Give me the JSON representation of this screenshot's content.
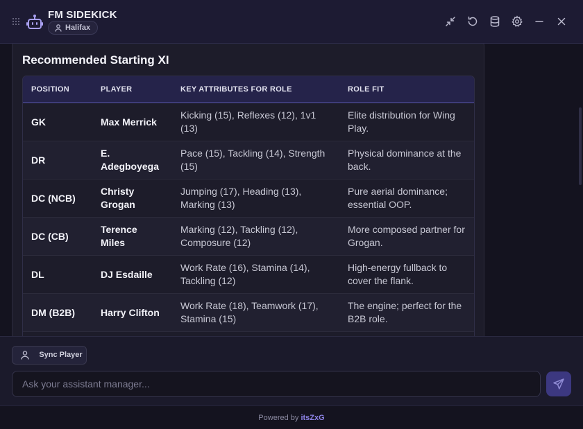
{
  "app": {
    "title": "FM SIDEKICK",
    "team": "Halifax"
  },
  "header_buttons": [
    "collapse-icon",
    "refresh-icon",
    "database-icon",
    "settings-icon",
    "minimize-icon",
    "close-icon"
  ],
  "section_title": "Recommended Starting XI",
  "table": {
    "headers": [
      "POSITION",
      "PLAYER",
      "KEY ATTRIBUTES FOR ROLE",
      "ROLE FIT"
    ],
    "rows": [
      {
        "position": "GK",
        "player": "Max Merrick",
        "attributes": "Kicking (15), Reflexes (12), 1v1 (13)",
        "fit": "Elite distribution for Wing Play."
      },
      {
        "position": "DR",
        "player": "E. Adegboyega",
        "attributes": "Pace (15), Tackling (14), Strength (15)",
        "fit": "Physical dominance at the back."
      },
      {
        "position": "DC (NCB)",
        "player": "Christy Grogan",
        "attributes": "Jumping (17), Heading (13), Marking (13)",
        "fit": "Pure aerial dominance; essential OOP."
      },
      {
        "position": "DC (CB)",
        "player": "Terence Miles",
        "attributes": "Marking (12), Tackling (12), Composure (12)",
        "fit": "More composed partner for Grogan."
      },
      {
        "position": "DL",
        "player": "DJ Esdaille",
        "attributes": "Work Rate (16), Stamina (14), Tackling (12)",
        "fit": "High-energy fullback to cover the flank."
      },
      {
        "position": "DM (B2B)",
        "player": "Harry Clifton",
        "attributes": "Work Rate (18), Teamwork (17), Stamina (15)",
        "fit": "The engine; perfect for the B2B role."
      }
    ]
  },
  "sync_button": "Sync Player",
  "input": {
    "placeholder": "Ask your assistant manager...",
    "value": ""
  },
  "footer": {
    "prefix": "Powered by",
    "brand": "itsZxG"
  },
  "colors": {
    "accent": "#3c3880",
    "brand": "#8d83e6",
    "header_bg": "#1d1b33"
  }
}
